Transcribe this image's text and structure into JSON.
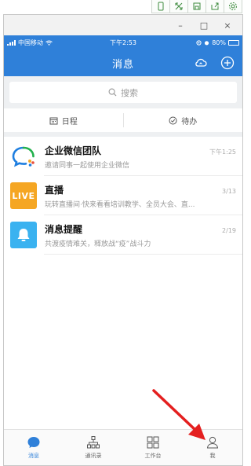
{
  "emulator_toolbar": {
    "icons": [
      "phone-icon",
      "fullscreen-icon",
      "save-icon",
      "export-icon",
      "settings-icon"
    ]
  },
  "window": {
    "minimize": "–",
    "maximize": "□",
    "close": "×"
  },
  "status_bar": {
    "carrier": "中国移动",
    "time": "下午2:53",
    "battery": "80%",
    "battery_level": 0.8
  },
  "header": {
    "title": "消息",
    "actions": [
      "cloud-icon",
      "add-icon"
    ]
  },
  "search": {
    "placeholder": "搜索"
  },
  "quick_tabs": [
    {
      "label": "日程",
      "icon": "calendar-icon"
    },
    {
      "label": "待办",
      "icon": "check-circle-icon"
    }
  ],
  "messages": [
    {
      "title": "企业微信团队",
      "subtitle": "邀请同事一起使用企业微信",
      "time": "下午1:25"
    },
    {
      "title": "直播",
      "subtitle": "玩转直播间·快来看看培训教学、全员大会、直...",
      "time": "3/13",
      "badge": "LIVE"
    },
    {
      "title": "消息提醒",
      "subtitle": "共渡疫情难关，释放战“疫”战斗力",
      "time": "2/19"
    }
  ],
  "tabs": [
    {
      "label": "消息",
      "icon": "chat-icon",
      "active": true
    },
    {
      "label": "通讯录",
      "icon": "contacts-icon",
      "active": false
    },
    {
      "label": "工作台",
      "icon": "workbench-icon",
      "active": false
    },
    {
      "label": "我",
      "icon": "person-icon",
      "active": false
    }
  ],
  "colors": {
    "accent": "#2f80d9",
    "live_badge": "#f5a623",
    "notice": "#3ab2f0",
    "annotation_arrow": "#e41f1f"
  }
}
